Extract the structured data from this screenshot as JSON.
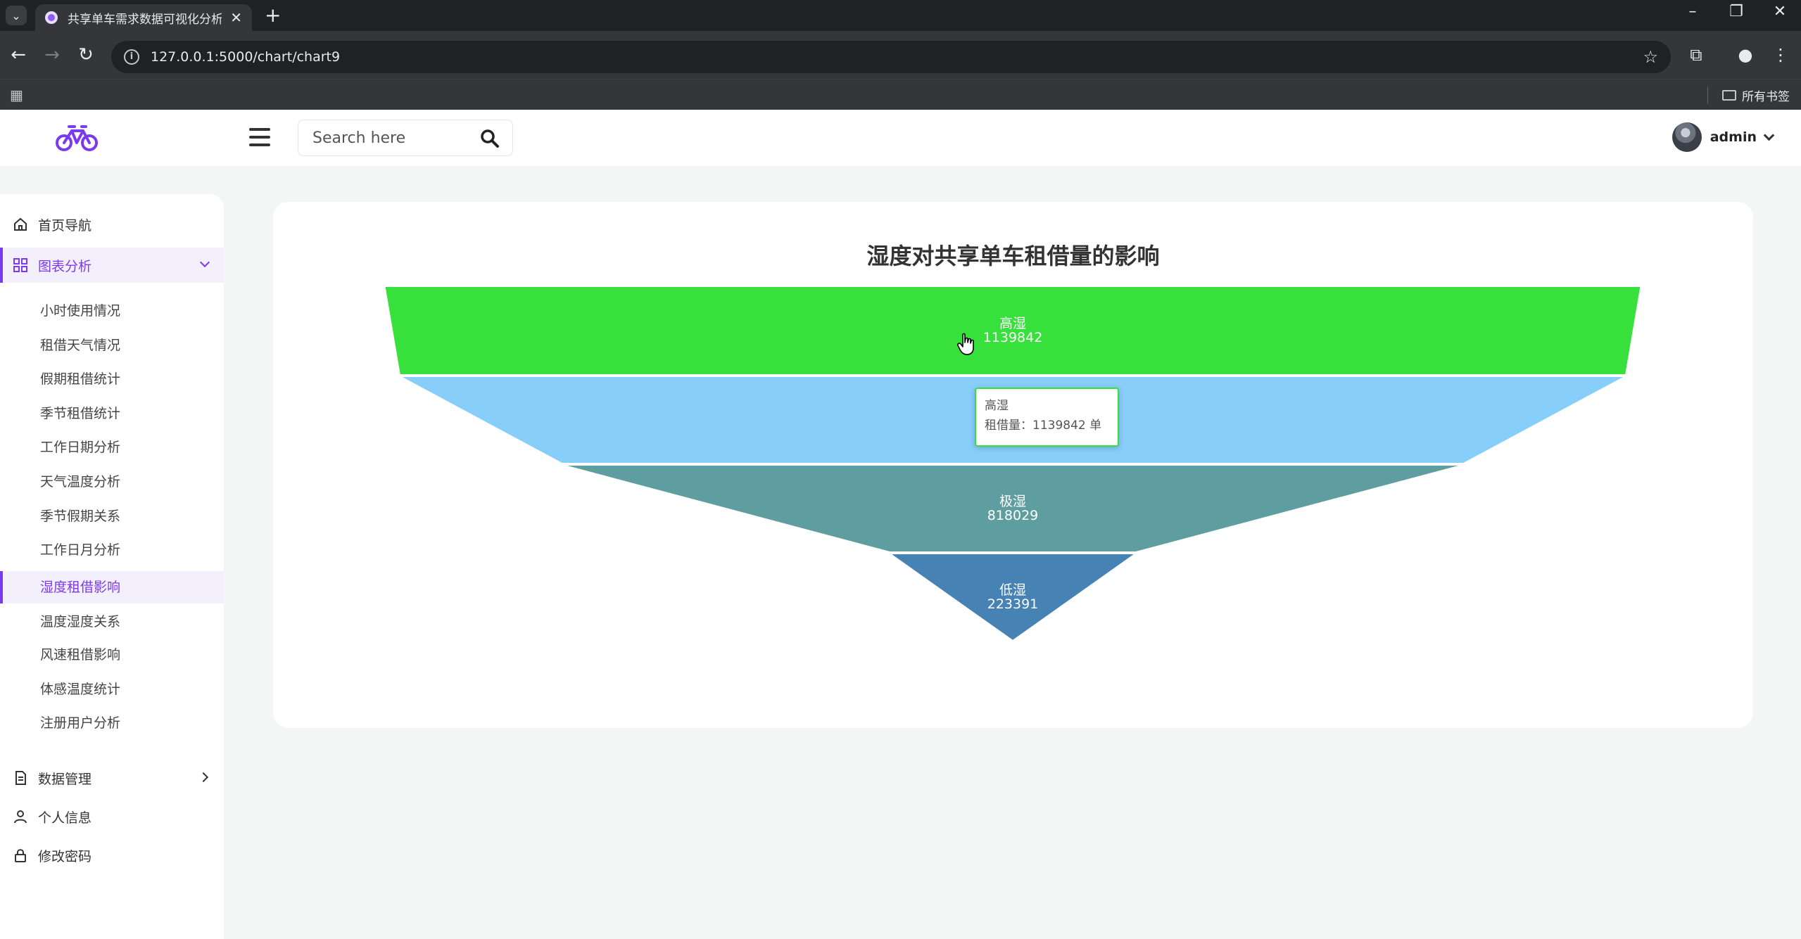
{
  "browser": {
    "tab_title": "共享单车需求数据可视化分析系",
    "url": "127.0.0.1:5000/chart/chart9",
    "bookmarks_label": "所有书签"
  },
  "header": {
    "search_placeholder": "Search here",
    "user_name": "admin"
  },
  "sidebar": {
    "home": "首页导航",
    "charts": "图表分析",
    "chart_items": [
      "小时使用情况",
      "租借天气情况",
      "假期租借统计",
      "季节租借统计",
      "工作日期分析",
      "天气温度分析",
      "季节假期关系",
      "工作日月分析",
      "湿度租借影响",
      "温度湿度关系",
      "风速租借影响",
      "体感温度统计",
      "注册用户分析"
    ],
    "active_index": 8,
    "data_mgmt": "数据管理",
    "profile": "个人信息",
    "password": "修改密码"
  },
  "chart_data": {
    "type": "funnel",
    "title": "湿度对共享单车租借量的影响",
    "series": [
      {
        "name": "高湿",
        "value": 1139842,
        "color": "#37e03a"
      },
      {
        "name": "高湿",
        "value": 1139842,
        "color": "#87cefa",
        "label_hidden": true
      },
      {
        "name": "极湿",
        "value": 818029,
        "color": "#5f9ea0"
      },
      {
        "name": "低湿",
        "value": 223391,
        "color": "#4682b4"
      }
    ],
    "tooltip": {
      "name": "高湿",
      "line": "租借量：1139842 单"
    }
  }
}
